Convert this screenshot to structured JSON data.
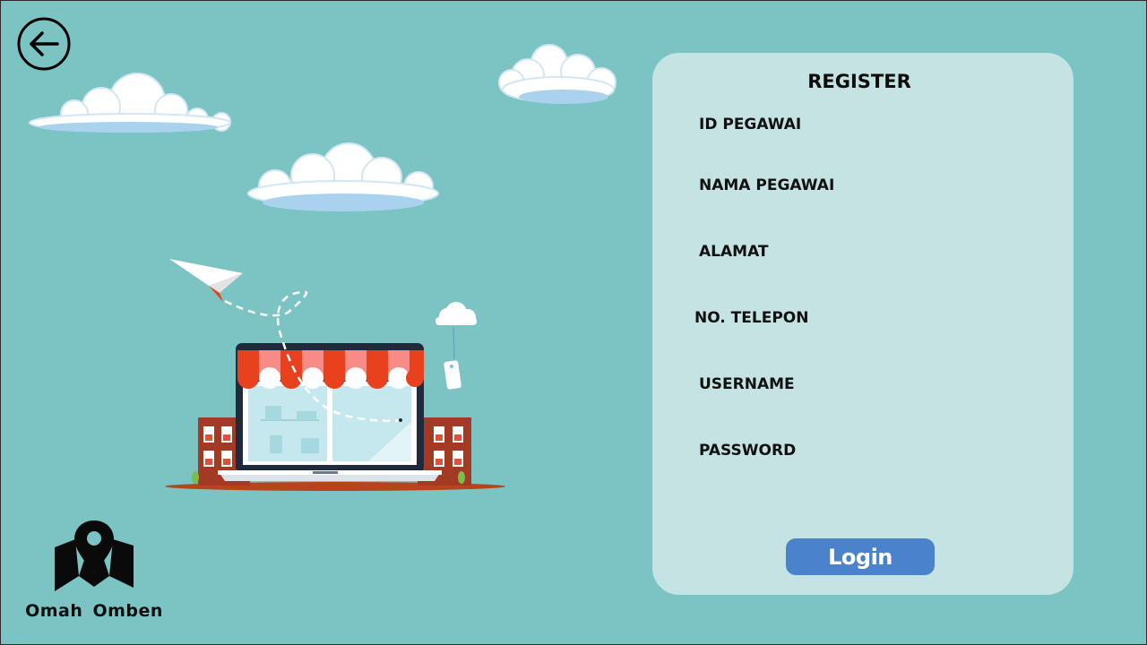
{
  "colors": {
    "background": "#7cc4c4",
    "panel": "#c5e3e2",
    "login_button": "#4a82cc",
    "text": "#111111"
  },
  "navigation": {
    "back_icon": "arrow-left-circle-icon"
  },
  "brand": {
    "icon": "map-pin-icon",
    "name": "Omah Omben"
  },
  "illustration": {
    "icon": "online-store-laptop-icon"
  },
  "register_form": {
    "title": "REGISTER",
    "fields": [
      {
        "label": "ID PEGAWAI"
      },
      {
        "label": "NAMA PEGAWAI"
      },
      {
        "label": "ALAMAT"
      },
      {
        "label": "NO. TELEPON"
      },
      {
        "label": "USERNAME"
      },
      {
        "label": "PASSWORD"
      }
    ],
    "login_label": "Login"
  }
}
